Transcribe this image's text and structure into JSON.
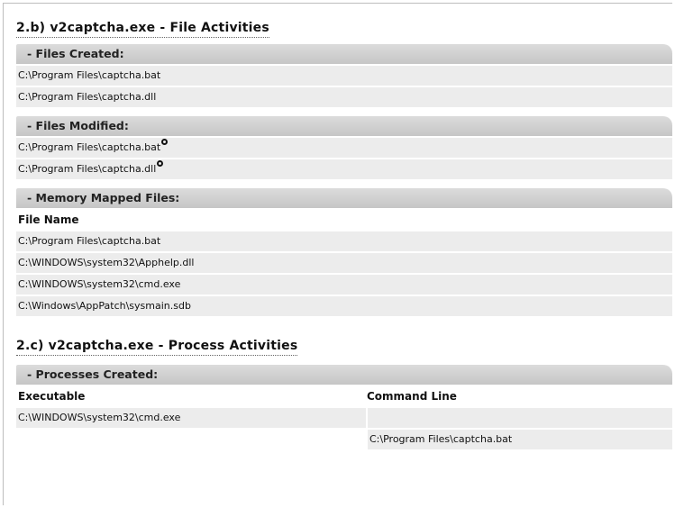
{
  "file_section": {
    "title": "2.b) v2captcha.exe - File Activities",
    "files_created": {
      "header": "- Files Created:",
      "rows": [
        "C:\\Program Files\\captcha.bat",
        "C:\\Program Files\\captcha.dll"
      ]
    },
    "files_modified": {
      "header": "- Files Modified:",
      "rows": [
        "C:\\Program Files\\captcha.bat",
        "C:\\Program Files\\captcha.dll"
      ]
    },
    "memory_mapped": {
      "header": "- Memory Mapped Files:",
      "column": "File Name",
      "rows": [
        "C:\\Program Files\\captcha.bat",
        "C:\\WINDOWS\\system32\\Apphelp.dll",
        "C:\\WINDOWS\\system32\\cmd.exe",
        "C:\\Windows\\AppPatch\\sysmain.sdb"
      ]
    }
  },
  "process_section": {
    "title": "2.c) v2captcha.exe - Process Activities",
    "processes_created": {
      "header": "- Processes Created:",
      "col_executable": "Executable",
      "col_command": "Command Line",
      "rows": [
        {
          "executable": "C:\\WINDOWS\\system32\\cmd.exe",
          "command": ""
        },
        {
          "executable": "",
          "command": "C:\\Program Files\\captcha.bat"
        }
      ]
    }
  }
}
